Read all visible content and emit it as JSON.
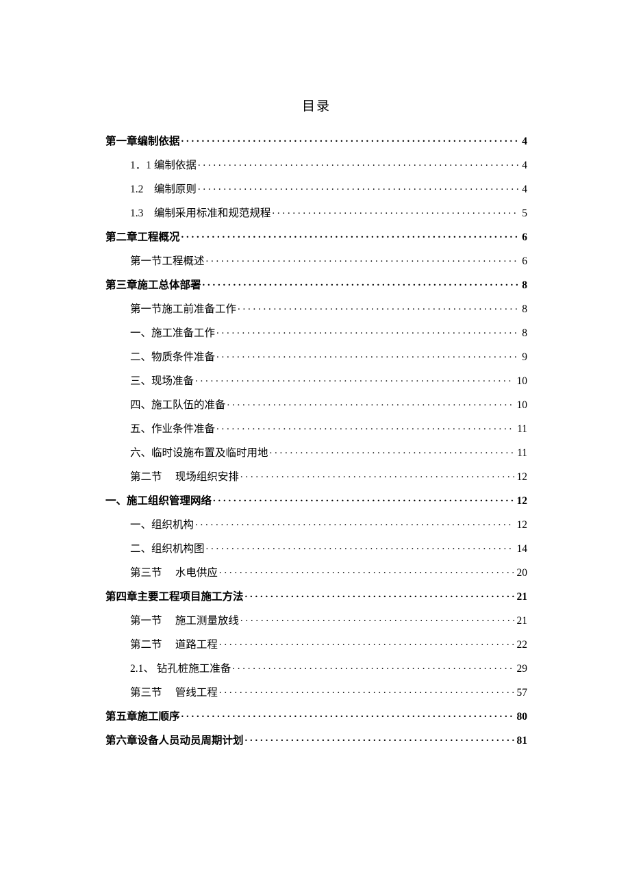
{
  "title": "目录",
  "toc": [
    {
      "label": "第一章编制依据",
      "page": "4",
      "indent": 0,
      "bold": true
    },
    {
      "label": "1．1 编制依据",
      "page": "4",
      "indent": 1,
      "bold": false
    },
    {
      "label": "1.2　编制原则",
      "page": "4",
      "indent": 1,
      "bold": false
    },
    {
      "label": "1.3　编制采用标准和规范规程",
      "page": "5",
      "indent": 1,
      "bold": false
    },
    {
      "label": "第二章工程概况",
      "page": "6",
      "indent": 0,
      "bold": true
    },
    {
      "label": "第一节工程概述",
      "page": "6",
      "indent": 1,
      "bold": false
    },
    {
      "label": "第三章施工总体部署",
      "page": "8",
      "indent": 0,
      "bold": true
    },
    {
      "label": "第一节施工前准备工作",
      "page": "8",
      "indent": 1,
      "bold": false
    },
    {
      "label": "一、施工准备工作",
      "page": "8",
      "indent": 1,
      "bold": false
    },
    {
      "label": "二、物质条件准备",
      "page": "9",
      "indent": 1,
      "bold": false
    },
    {
      "label": "三、现场准备",
      "page": "10",
      "indent": 1,
      "bold": false
    },
    {
      "label": "四、施工队伍的准备",
      "page": "10",
      "indent": 1,
      "bold": false
    },
    {
      "label": "五、作业条件准备",
      "page": "11",
      "indent": 1,
      "bold": false
    },
    {
      "label": "六、临时设施布置及临时用地",
      "page": "11",
      "indent": 1,
      "bold": false
    },
    {
      "label": "第二节　 现场组织安排",
      "page": "12",
      "indent": 1,
      "bold": false
    },
    {
      "label": "一、施工组织管理网络",
      "page": "12",
      "indent": 0,
      "bold": true
    },
    {
      "label": "一、组织机构",
      "page": "12",
      "indent": 1,
      "bold": false
    },
    {
      "label": "二、组织机构图",
      "page": "14",
      "indent": 1,
      "bold": false
    },
    {
      "label": "第三节　 水电供应",
      "page": "20",
      "indent": 1,
      "bold": false
    },
    {
      "label": "第四章主要工程项目施工方法",
      "page": "21",
      "indent": 0,
      "bold": true
    },
    {
      "label": "第一节　 施工测量放线",
      "page": "21",
      "indent": 1,
      "bold": false
    },
    {
      "label": "第二节　 道路工程",
      "page": "22",
      "indent": 1,
      "bold": false
    },
    {
      "label": "2.1、 钻孔桩施工准备",
      "page": "29",
      "indent": 1,
      "bold": false
    },
    {
      "label": "第三节　 管线工程",
      "page": "57",
      "indent": 1,
      "bold": false
    },
    {
      "label": "第五章施工顺序",
      "page": "80",
      "indent": 0,
      "bold": true
    },
    {
      "label": "第六章设备人员动员周期计划",
      "page": "81",
      "indent": 0,
      "bold": true
    }
  ]
}
